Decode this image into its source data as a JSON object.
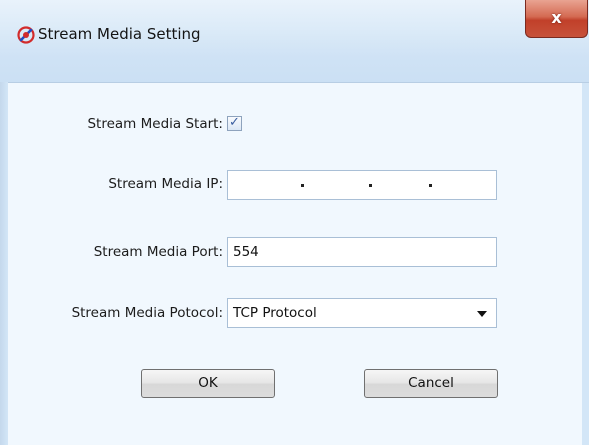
{
  "window": {
    "title": "Stream Media Setting",
    "close_label": "x",
    "icon": "app-logo-icon",
    "accent": "#c43a2a"
  },
  "form": {
    "start_label": "Stream Media Start:",
    "start_checked": true,
    "ip_label": "Stream Media IP:",
    "ip_value": "",
    "port_label": "Stream Media Port:",
    "port_value": "554",
    "protocol_label": "Stream Media Potocol:",
    "protocol_value": "TCP Protocol"
  },
  "buttons": {
    "ok_label": "OK",
    "cancel_label": "Cancel"
  }
}
